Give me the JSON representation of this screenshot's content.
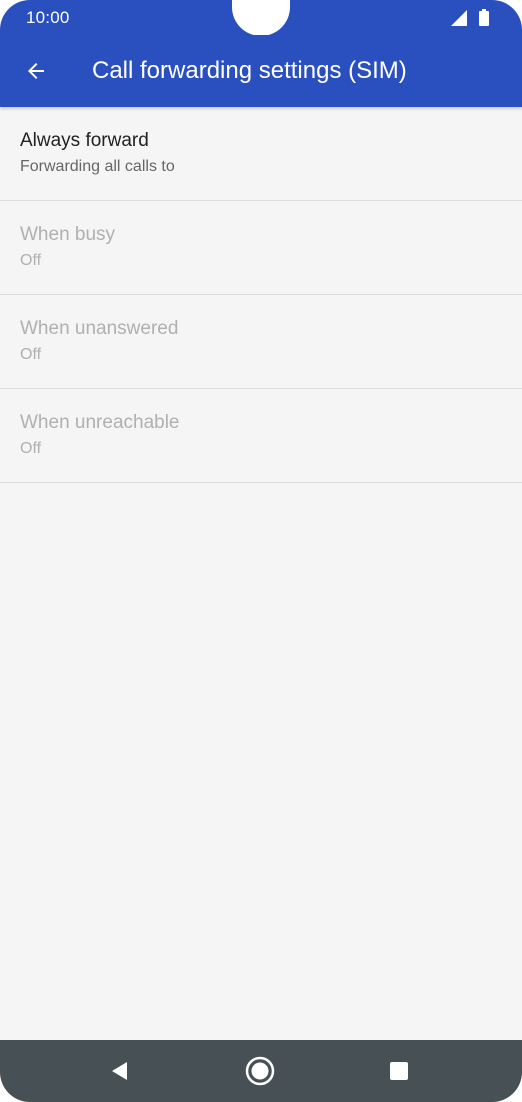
{
  "status_bar": {
    "time": "10:00",
    "signal_icon": "signal-icon",
    "battery_icon": "battery-icon"
  },
  "app_bar": {
    "back_icon": "arrow-back-icon",
    "title": "Call forwarding settings (SIM)",
    "color": "#2a4fbe"
  },
  "items": [
    {
      "title": "Always forward",
      "summary": "Forwarding all calls to",
      "enabled": true
    },
    {
      "title": "When busy",
      "summary": "Off",
      "enabled": false
    },
    {
      "title": "When unanswered",
      "summary": "Off",
      "enabled": false
    },
    {
      "title": "When unreachable",
      "summary": "Off",
      "enabled": false
    }
  ],
  "nav_bar": {
    "back_icon": "nav-back-icon",
    "home_icon": "nav-home-icon",
    "recents_icon": "nav-recents-icon",
    "color": "#475055"
  }
}
